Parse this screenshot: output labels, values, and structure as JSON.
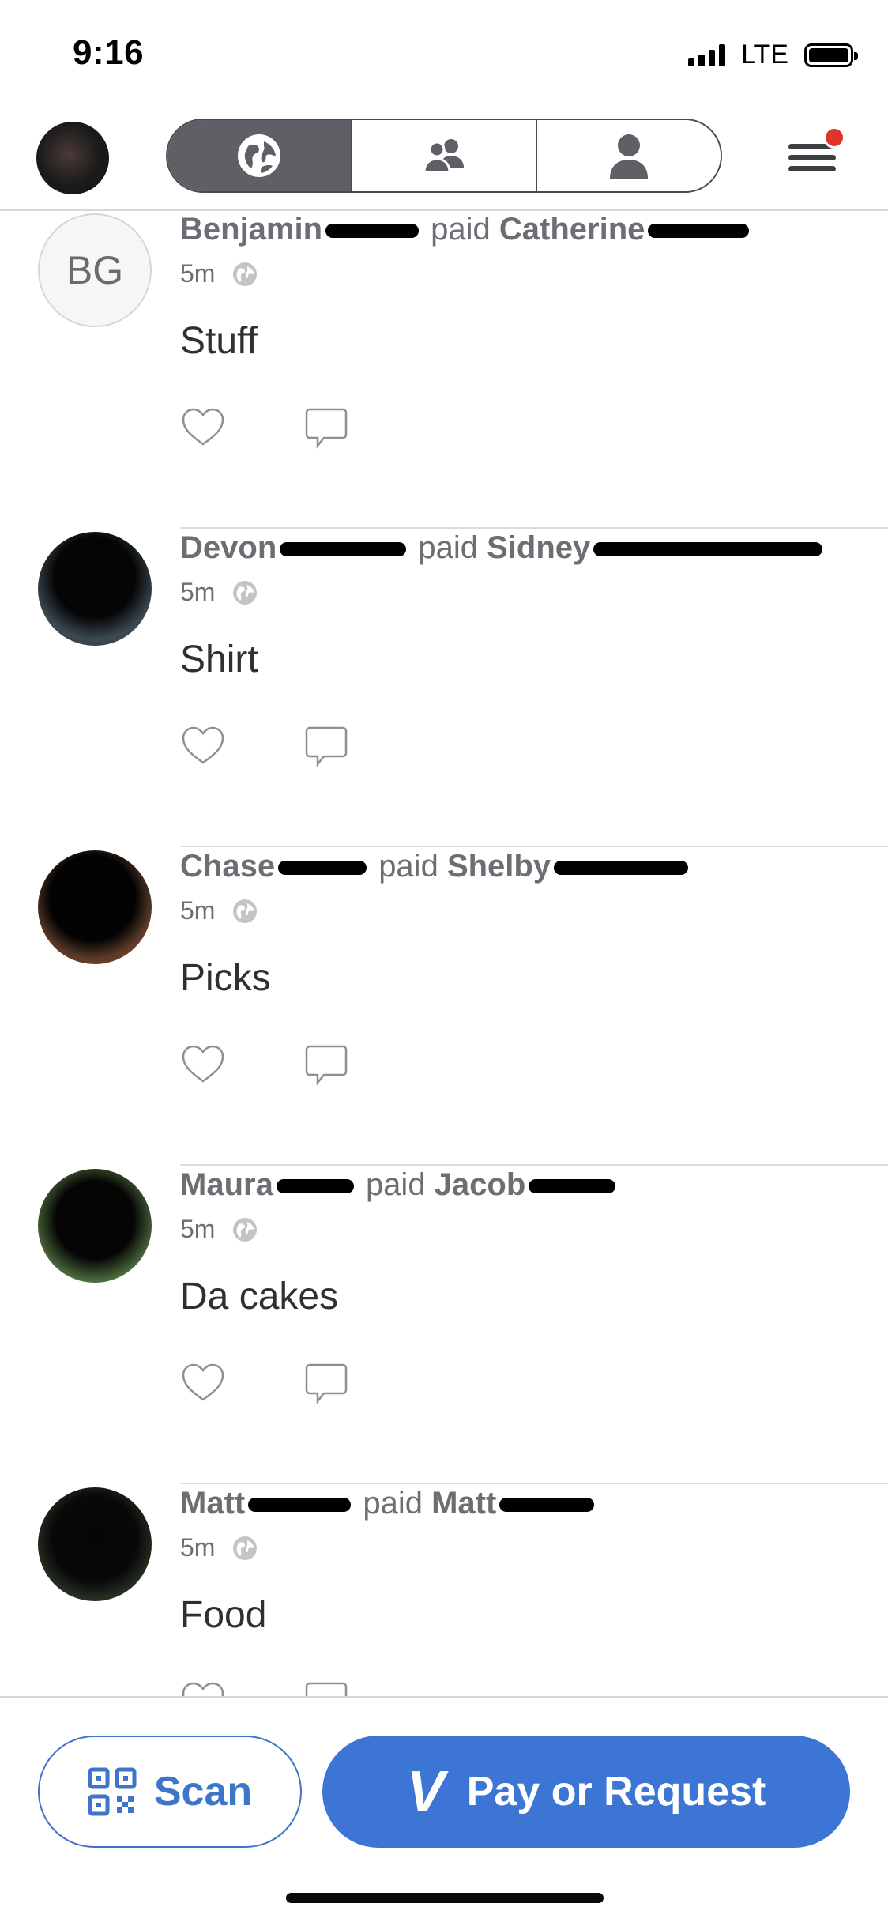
{
  "status_bar": {
    "time": "9:16",
    "network": "LTE"
  },
  "nav": {
    "tabs": [
      {
        "icon": "globe-icon",
        "active": true
      },
      {
        "icon": "friends-icon",
        "active": false
      },
      {
        "icon": "person-icon",
        "active": false
      }
    ],
    "menu_has_notification": true
  },
  "stories": [
    {
      "avatar_initials": "BG",
      "sender": "Benjamin",
      "action": "paid",
      "recipient": "Catherine",
      "time": "5m",
      "note": "Stuff"
    },
    {
      "avatar_initials": "",
      "sender": "Devon",
      "action": "paid",
      "recipient": "Sidney",
      "time": "5m",
      "note": "Shirt"
    },
    {
      "avatar_initials": "",
      "sender": "Chase",
      "action": "paid",
      "recipient": "Shelby",
      "time": "5m",
      "note": "Picks"
    },
    {
      "avatar_initials": "",
      "sender": "Maura",
      "action": "paid",
      "recipient": "Jacob",
      "time": "5m",
      "note": "Da cakes"
    },
    {
      "avatar_initials": "",
      "sender": "Matt",
      "action": "paid",
      "recipient": "Matt",
      "time": "5m",
      "note": "Food"
    }
  ],
  "bottom": {
    "scan_label": "Scan",
    "pay_label": "Pay or Request"
  },
  "colors": {
    "accent": "#3d75d4",
    "notification": "#e0332c",
    "segment_active": "#5f6065"
  }
}
